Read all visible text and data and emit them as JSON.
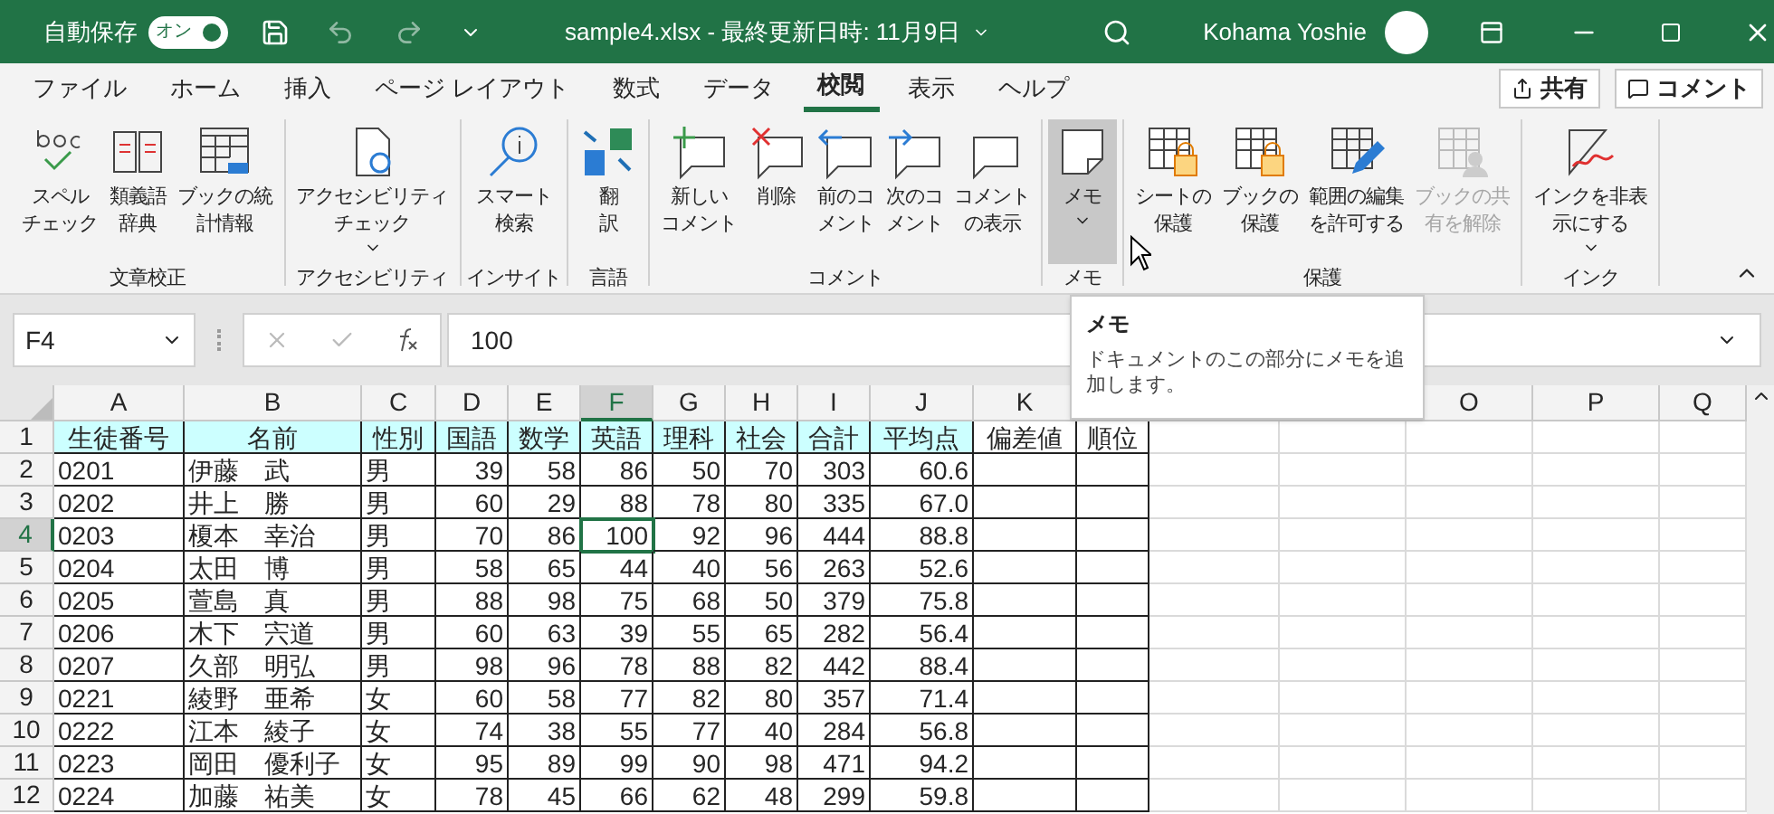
{
  "title_bar": {
    "autosave": {
      "label": "自動保存",
      "toggle_text": "オン",
      "on": true
    },
    "document_title": "sample4.xlsx - 最終更新日時: 11月9日",
    "user_name": "Kohama Yoshie"
  },
  "menu_tabs": [
    {
      "label": "ファイル",
      "selected": false
    },
    {
      "label": "ホーム",
      "selected": false
    },
    {
      "label": "挿入",
      "selected": false
    },
    {
      "label": "ページ レイアウト",
      "selected": false
    },
    {
      "label": "数式",
      "selected": false
    },
    {
      "label": "データ",
      "selected": false
    },
    {
      "label": "校閲",
      "selected": true
    },
    {
      "label": "表示",
      "selected": false
    },
    {
      "label": "ヘルプ",
      "selected": false
    }
  ],
  "share_button": "共有",
  "comment_button": "コメント",
  "ribbon": {
    "groups": [
      {
        "label": "文章校正",
        "buttons": [
          {
            "kind": "spell",
            "lines": [
              "スペル",
              "チェック"
            ]
          },
          {
            "kind": "thesaurus",
            "lines": [
              "類義語",
              "辞典"
            ]
          },
          {
            "kind": "stats",
            "lines": [
              "ブックの統",
              "計情報"
            ]
          }
        ]
      },
      {
        "label": "アクセシビリティ",
        "buttons": [
          {
            "kind": "accessibility",
            "lines": [
              "アクセシビリティ",
              "チェック"
            ],
            "dropdown": true
          }
        ]
      },
      {
        "label": "インサイト",
        "buttons": [
          {
            "kind": "smart",
            "lines": [
              "スマート",
              "検索"
            ]
          }
        ]
      },
      {
        "label": "言語",
        "buttons": [
          {
            "kind": "translate",
            "lines": [
              "翻",
              "訳"
            ]
          }
        ]
      },
      {
        "label": "コメント",
        "buttons": [
          {
            "kind": "new-comment",
            "lines": [
              "新しい",
              "コメント"
            ]
          },
          {
            "kind": "delete-comment",
            "lines": [
              "削除"
            ]
          },
          {
            "kind": "prev-comment",
            "lines": [
              "前のコ",
              "メント"
            ]
          },
          {
            "kind": "next-comment",
            "lines": [
              "次のコ",
              "メント"
            ]
          },
          {
            "kind": "show-comments",
            "lines": [
              "コメント",
              "の表示"
            ]
          }
        ]
      },
      {
        "label": "メモ",
        "buttons": [
          {
            "kind": "note",
            "lines": [
              "メモ"
            ],
            "dropdown": true,
            "selected": true
          }
        ]
      },
      {
        "label": "保護",
        "buttons": [
          {
            "kind": "protect-sheet",
            "lines": [
              "シートの",
              "保護"
            ]
          },
          {
            "kind": "protect-book",
            "lines": [
              "ブックの",
              "保護"
            ]
          },
          {
            "kind": "allow-edit",
            "lines": [
              "範囲の編集",
              "を許可する"
            ]
          },
          {
            "kind": "unshare",
            "lines": [
              "ブックの共",
              "有を解除"
            ],
            "disabled": true
          }
        ]
      },
      {
        "label": "インク",
        "buttons": [
          {
            "kind": "ink",
            "lines": [
              "インクを非表",
              "示にする"
            ],
            "dropdown": true
          }
        ]
      }
    ]
  },
  "name_box": "F4",
  "formula": "100",
  "tooltip": {
    "title": "メモ",
    "text": "ドキュメントのこの部分にメモを追加します。"
  },
  "sheet": {
    "columns": [
      {
        "label": "A",
        "selected": false
      },
      {
        "label": "B",
        "selected": false
      },
      {
        "label": "C",
        "selected": false
      },
      {
        "label": "D",
        "selected": false
      },
      {
        "label": "E",
        "selected": false
      },
      {
        "label": "F",
        "selected": true
      },
      {
        "label": "G",
        "selected": false
      },
      {
        "label": "H",
        "selected": false
      },
      {
        "label": "I",
        "selected": false
      },
      {
        "label": "J",
        "selected": false
      },
      {
        "label": "K",
        "selected": false
      },
      {
        "selected": false
      },
      {
        "selected": false
      },
      {
        "selected": false
      },
      {
        "label": "O",
        "selected": false
      },
      {
        "label": "P",
        "selected": false
      },
      {
        "label": "Q",
        "selected": false
      }
    ],
    "rows": [
      {
        "number": "1",
        "selected": false,
        "cells": [
          {
            "text": "生徒番号",
            "highlighted": true
          },
          {
            "text": "名前",
            "highlighted": true
          },
          {
            "text": "性別",
            "highlighted": true
          },
          {
            "text": "国語",
            "highlighted": true
          },
          {
            "text": "数学",
            "highlighted": true
          },
          {
            "text": "英語",
            "highlighted": true
          },
          {
            "text": "理科",
            "highlighted": true
          },
          {
            "text": "社会",
            "highlighted": true
          },
          {
            "text": "合計",
            "highlighted": true
          },
          {
            "text": "平均点",
            "highlighted": true
          },
          {
            "text": "偏差値",
            "highlighted": false
          },
          {
            "text": "順位",
            "highlighted": false
          }
        ]
      },
      {
        "number": "2",
        "selected": false,
        "cells": [
          "0201",
          "伊藤　武",
          "男",
          "39",
          "58",
          "86",
          "50",
          "70",
          "303",
          "60.6"
        ]
      },
      {
        "number": "3",
        "selected": false,
        "cells": [
          "0202",
          "井上　勝",
          "男",
          "60",
          "29",
          "88",
          "78",
          "80",
          "335",
          "67.0"
        ]
      },
      {
        "number": "4",
        "selected": true,
        "cells": [
          "0203",
          "榎本　幸治",
          "男",
          "70",
          "86",
          "100",
          "92",
          "96",
          "444",
          "88.8"
        ]
      },
      {
        "number": "5",
        "selected": false,
        "cells": [
          "0204",
          "太田　博",
          "男",
          "58",
          "65",
          "44",
          "40",
          "56",
          "263",
          "52.6"
        ]
      },
      {
        "number": "6",
        "selected": false,
        "cells": [
          "0205",
          "萱島　真",
          "男",
          "88",
          "98",
          "75",
          "68",
          "50",
          "379",
          "75.8"
        ]
      },
      {
        "number": "7",
        "selected": false,
        "cells": [
          "0206",
          "木下　宍道",
          "男",
          "60",
          "63",
          "39",
          "55",
          "65",
          "282",
          "56.4"
        ]
      },
      {
        "number": "8",
        "selected": false,
        "cells": [
          "0207",
          "久部　明弘",
          "男",
          "98",
          "96",
          "78",
          "88",
          "82",
          "442",
          "88.4"
        ]
      },
      {
        "number": "9",
        "selected": false,
        "cells": [
          "0221",
          "綾野　亜希",
          "女",
          "60",
          "58",
          "77",
          "82",
          "80",
          "357",
          "71.4"
        ]
      },
      {
        "number": "10",
        "selected": false,
        "cells": [
          "0222",
          "江本　綾子",
          "女",
          "74",
          "38",
          "55",
          "77",
          "40",
          "284",
          "56.8"
        ]
      },
      {
        "number": "11",
        "selected": false,
        "cells": [
          "0223",
          "岡田　優利子",
          "女",
          "95",
          "89",
          "99",
          "90",
          "98",
          "471",
          "94.2"
        ]
      },
      {
        "number": "12",
        "selected": false,
        "cells": [
          "0224",
          "加藤　祐美",
          "女",
          "78",
          "45",
          "66",
          "62",
          "48",
          "299",
          "59.8"
        ]
      }
    ]
  }
}
